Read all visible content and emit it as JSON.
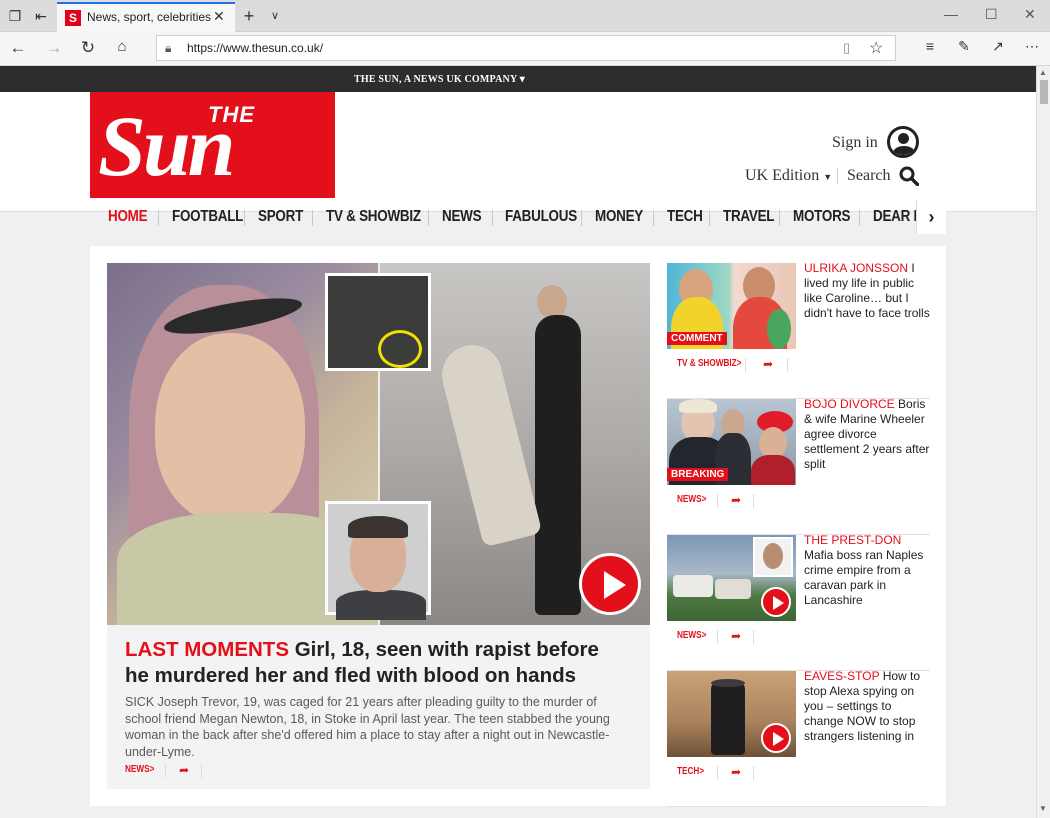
{
  "browser": {
    "tab_title": "News, sport, celebrities",
    "favicon_letter": "S",
    "url": "https://www.thesun.co.uk/"
  },
  "header": {
    "company_strip": "THE SUN, A NEWS UK COMPANY ▾",
    "logo_the": "THE",
    "logo_sun": "Sun",
    "sign_in": "Sign in",
    "edition": "UK Edition",
    "search": "Search"
  },
  "nav": {
    "items": [
      "HOME",
      "FOOTBALL",
      "SPORT",
      "TV & SHOWBIZ",
      "NEWS",
      "FABULOUS",
      "MONEY",
      "TECH",
      "TRAVEL",
      "MOTORS",
      "DEAR D"
    ],
    "active": "HOME"
  },
  "hero": {
    "kicker": "LAST MOMENTS",
    "headline": "Girl, 18, seen with rapist before he murdered her and fled with blood on hands",
    "summary": "SICK Joseph Trevor, 19, was caged for 21 years after pleading guilty to the murder of school friend Megan Newton, 18, in Stoke in April last year. The teen stabbed the young woman in the back after she'd offered him a place to stay after a night out in Newcastle-under-Lyme.",
    "tag": "NEWS>"
  },
  "stories": [
    {
      "kicker": "ULRIKA JONSSON",
      "headline": "I lived my life in public like Caroline… but I didn't have to face trolls",
      "label": "COMMENT",
      "tag": "TV & SHOWBIZ>"
    },
    {
      "kicker": "BOJO DIVORCE",
      "headline": "Boris & wife Marine Wheeler agree divorce settlement 2 years after split",
      "label": "BREAKING",
      "tag": "NEWS>"
    },
    {
      "kicker": "THE PREST-DON",
      "headline": "Mafia boss ran Naples crime empire from a caravan park in Lancashire",
      "label": "",
      "tag": "NEWS>"
    },
    {
      "kicker": "EAVES-STOP",
      "headline": "How to stop Alexa spying on you – settings to change NOW to stop strangers listening in",
      "label": "",
      "tag": "TECH>"
    }
  ],
  "colors": {
    "brand_red": "#e3101b",
    "strip": "#2d2d2d",
    "page_bg": "#eef0f1"
  }
}
